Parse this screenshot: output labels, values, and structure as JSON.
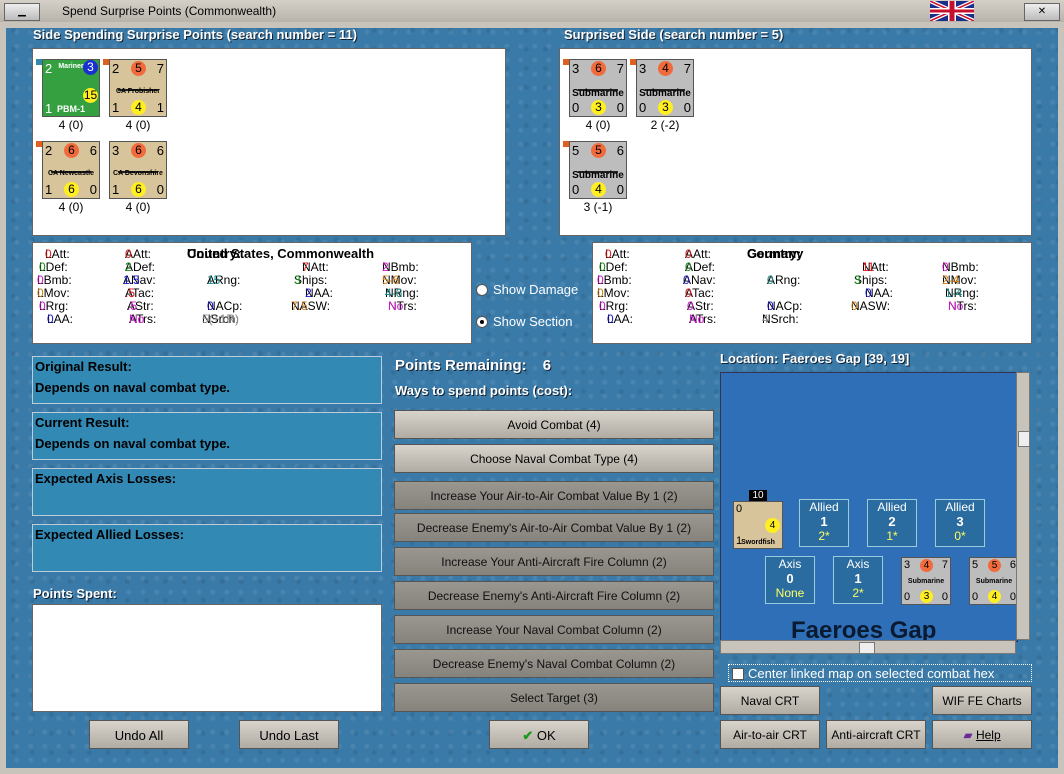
{
  "window": {
    "title": "Spend Surprise Points (Commonwealth)"
  },
  "left_side": {
    "header": "Side Spending Surprise Points (search number = 11)",
    "units": [
      {
        "name": "Mariner",
        "sub": "PBM-1",
        "tl": "2",
        "tr": "3",
        "mr": "15",
        "bl": "1",
        "val": "4 (0)"
      },
      {
        "name": "CA Frobisher",
        "tl": "2",
        "tm": "5",
        "tr": "7",
        "bl": "1",
        "bm": "4",
        "br": "1",
        "val": "4 (0)"
      },
      {
        "name": "CA Newcastle",
        "tl": "2",
        "tm": "6",
        "tr": "6",
        "bl": "1",
        "bm": "6",
        "br": "0",
        "val": "4 (0)"
      },
      {
        "name": "CA Devonshire",
        "tl": "3",
        "tm": "6",
        "tr": "6",
        "bl": "1",
        "bm": "6",
        "br": "0",
        "val": "4 (0)"
      }
    ]
  },
  "right_side": {
    "header": "Surprised Side (search number = 5)",
    "units": [
      {
        "name": "Submarine",
        "tl": "3",
        "tm": "6",
        "tr": "7",
        "bl": "0",
        "bm": "3",
        "br": "0",
        "val": "4 (0)"
      },
      {
        "name": "Submarine",
        "tl": "3",
        "tm": "4",
        "tr": "7",
        "bl": "0",
        "bm": "3",
        "br": "0",
        "val": "2 (-2)"
      },
      {
        "name": "Submarine",
        "tl": "5",
        "tm": "5",
        "tr": "6",
        "bl": "0",
        "bm": "4",
        "br": "0",
        "val": "3 (-1)"
      }
    ]
  },
  "stats_left": {
    "country_label": "Country:",
    "country": "United States, Commonwealth",
    "LAtt": "0",
    "AAtt": "0",
    "NAtt": "7",
    "NBmb": "2",
    "LDef": "0",
    "ADef": "2",
    "Ships": "3",
    "NMov": "5-6",
    "LBmb": "0",
    "ANav": "1.5",
    "ARng": "15",
    "NAA": "2",
    "NRng": "4-6",
    "LMov": "0",
    "ATac": ".5",
    "NASW": "7.5",
    "NTrs": "No",
    "LRrg": "0",
    "AStr": ".5",
    "NACp": "0",
    "LAA": "0",
    "ATrs": "No",
    "NSrch": "5(+1R)"
  },
  "stats_right": {
    "country_label": "Country:",
    "country": "Germany",
    "LAtt": "0",
    "AAtt": "0",
    "NAtt": "11",
    "NBmb": "0",
    "LDef": "0",
    "ADef": "0",
    "Ships": "3",
    "NMov": "2-4",
    "LBmb": "0",
    "ANav": "0",
    "ARng": "0",
    "NAA": "0",
    "NRng": "1-4",
    "LMov": "0",
    "ATac": "0",
    "NASW": "0",
    "NTrs": "No",
    "LRrg": "0",
    "AStr": "0",
    "NACp": "0",
    "LAA": "0",
    "ATrs": "No",
    "NSrch": "4"
  },
  "labels": {
    "LAtt": "LAtt:",
    "AAtt": "AAtt:",
    "NAtt": "NAtt:",
    "NBmb": "NBmb:",
    "LDef": "LDef:",
    "ADef": "ADef:",
    "Ships": "Ships:",
    "NMov": "NMov:",
    "LBmb": "LBmb:",
    "ANav": "ANav:",
    "ARng": "ARng:",
    "NAA": "NAA:",
    "NRng": "NRng:",
    "LMov": "LMov:",
    "ATac": "ATac:",
    "NASW": "NASW:",
    "NTrs": "NTrs:",
    "LRrg": "LRrg:",
    "AStr": "AStr:",
    "NACp": "NACp:",
    "LAA": "LAA:",
    "ATrs": "ATrs:",
    "NSrch": "NSrch:"
  },
  "options": {
    "show_damage": "Show Damage",
    "show_section": "Show Section",
    "selected": "show_section"
  },
  "results": {
    "original_label": "Original Result:",
    "original_value": "Depends on naval combat type.",
    "current_label": "Current Result:",
    "current_value": "Depends on naval combat type.",
    "axis_losses_label": "Expected Axis Losses:",
    "allied_losses_label": "Expected Allied Losses:",
    "points_spent_label": "Points Spent:"
  },
  "spend": {
    "points_remaining_label": "Points Remaining:",
    "points_remaining": "6",
    "ways_label": "Ways to spend points (cost):",
    "buttons": [
      "Avoid Combat (4)",
      "Choose Naval Combat Type (4)",
      "Increase Your Air-to-Air Combat Value By 1 (2)",
      "Decrease Enemy's Air-to-Air Combat Value By 1 (2)",
      "Increase Your Anti-Aircraft Fire Column (2)",
      "Decrease Enemy's Anti-Aircraft Fire Column (2)",
      "Increase Your Naval Combat Column (2)",
      "Decrease Enemy's Naval Combat Column (2)",
      "Select Target (3)"
    ]
  },
  "location": {
    "label": "Location: Faeroes Gap [39, 19]",
    "map_name": "Faeroes Gap"
  },
  "map": {
    "stack_count": "10",
    "unit_name": "Swordfish",
    "unit_vals": {
      "tl": "0",
      "mr": "4",
      "bl": "1"
    },
    "allied_boxes": [
      {
        "t": "Allied",
        "n": "1",
        "v": "2*"
      },
      {
        "t": "Allied",
        "n": "2",
        "v": "1*"
      },
      {
        "t": "Allied",
        "n": "3",
        "v": "0*"
      }
    ],
    "axis_boxes": [
      {
        "t": "Axis",
        "n": "0",
        "v": "None"
      },
      {
        "t": "Axis",
        "n": "1",
        "v": "2*"
      }
    ],
    "subs": [
      {
        "name": "Submarine",
        "tl": "3",
        "tm": "4",
        "tr": "7",
        "bl": "0",
        "bm": "3",
        "br": "0"
      },
      {
        "name": "Submarine",
        "tl": "5",
        "tm": "5",
        "tr": "6",
        "bl": "0",
        "bm": "4",
        "br": "0"
      }
    ]
  },
  "center_map_label": "Center linked map on selected combat hex",
  "bottom_buttons": {
    "undo_all": "Undo All",
    "undo_last": "Undo Last",
    "ok": "OK",
    "naval_crt": "Naval CRT",
    "wif_charts": "WIF FE Charts",
    "air_crt": "Air-to-air CRT",
    "aa_crt": "Anti-aircraft CRT",
    "help": "Help"
  }
}
